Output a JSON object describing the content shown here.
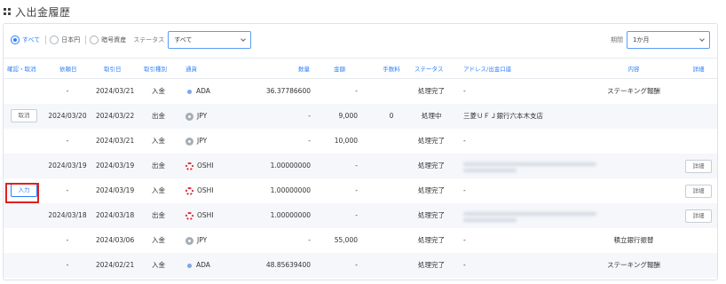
{
  "page": {
    "title": "入出金履歴"
  },
  "filters": {
    "asset_radios": [
      {
        "label": "すべて",
        "selected": true
      },
      {
        "label": "日本円",
        "selected": false
      },
      {
        "label": "暗号資産",
        "selected": false
      }
    ],
    "status_label": "ステータス",
    "status_value": "すべて",
    "period_label": "期間",
    "period_value": "1か月"
  },
  "table": {
    "headers": [
      "確認・取消",
      "依頼日",
      "取引日",
      "取引種別",
      "通貨",
      "数量",
      "金額",
      "手数料",
      "ステータス",
      "アドレス/出金口座",
      "内容",
      "詳細"
    ],
    "rows": [
      {
        "action": "",
        "request_date": "-",
        "trade_date": "2024/03/21",
        "type": "入金",
        "currency": "ADA",
        "icon": "ada-icon",
        "quantity": "36.37786600",
        "amount": "-",
        "fee": "",
        "status": "処理完了",
        "address": "-",
        "address_blurred": false,
        "content": "ステーキング報酬",
        "detail": ""
      },
      {
        "action": "取消",
        "request_date": "2024/03/20",
        "trade_date": "2024/03/22",
        "type": "出金",
        "currency": "JPY",
        "icon": "jpy-icon",
        "quantity": "-",
        "amount": "9,000",
        "fee": "0",
        "status": "処理中",
        "address": "三菱ＵＦＪ銀行六本木支店",
        "address_blurred": false,
        "content": "",
        "detail": ""
      },
      {
        "action": "",
        "request_date": "-",
        "trade_date": "2024/03/21",
        "type": "入金",
        "currency": "JPY",
        "icon": "jpy-icon",
        "quantity": "-",
        "amount": "10,000",
        "fee": "",
        "status": "処理完了",
        "address": "-",
        "address_blurred": false,
        "content": "",
        "detail": ""
      },
      {
        "action": "",
        "request_date": "2024/03/19",
        "trade_date": "2024/03/19",
        "type": "出金",
        "currency": "OSHI",
        "icon": "oshi-icon",
        "quantity": "1.00000000",
        "amount": "-",
        "fee": "",
        "status": "処理完了",
        "address": "",
        "address_blurred": true,
        "content": "",
        "detail": "詳細"
      },
      {
        "action": "入力",
        "request_date": "-",
        "trade_date": "2024/03/19",
        "type": "入金",
        "currency": "OSHI",
        "icon": "oshi-icon",
        "quantity": "1.00000000",
        "amount": "-",
        "fee": "",
        "status": "処理完了",
        "address": "-",
        "address_blurred": false,
        "content": "",
        "detail": "詳細"
      },
      {
        "action": "",
        "request_date": "2024/03/18",
        "trade_date": "2024/03/18",
        "type": "出金",
        "currency": "OSHI",
        "icon": "oshi-icon",
        "quantity": "1.00000000",
        "amount": "-",
        "fee": "",
        "status": "処理完了",
        "address": "",
        "address_blurred": true,
        "content": "",
        "detail": "詳細"
      },
      {
        "action": "",
        "request_date": "-",
        "trade_date": "2024/03/06",
        "type": "入金",
        "currency": "JPY",
        "icon": "jpy-icon",
        "quantity": "-",
        "amount": "55,000",
        "fee": "",
        "status": "処理完了",
        "address": "-",
        "address_blurred": false,
        "content": "積立銀行振替",
        "detail": ""
      },
      {
        "action": "",
        "request_date": "-",
        "trade_date": "2024/02/21",
        "type": "入金",
        "currency": "ADA",
        "icon": "ada-icon",
        "quantity": "48.85639400",
        "amount": "-",
        "fee": "",
        "status": "処理完了",
        "address": "-",
        "address_blurred": false,
        "content": "ステーキング報酬",
        "detail": ""
      }
    ]
  },
  "colors": {
    "accent": "#2d7ff9",
    "highlight": "#e02020",
    "row_alt": "#f5f7fa"
  }
}
